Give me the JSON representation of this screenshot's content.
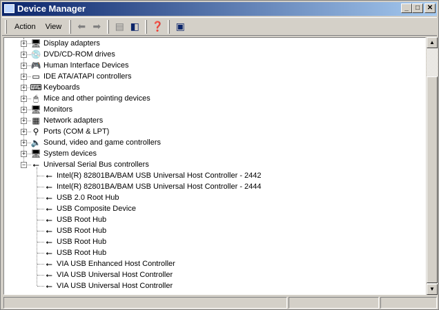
{
  "window": {
    "title": "Device Manager"
  },
  "menu": [
    {
      "label": "Action",
      "key": "A"
    },
    {
      "label": "View",
      "key": "V"
    }
  ],
  "toolbar": {
    "icons": [
      "back-icon",
      "forward-icon",
      "up-folder-icon",
      "show-hide-tree-icon",
      "help-icon",
      "properties-icon"
    ]
  },
  "tree": {
    "categories": [
      {
        "label": "Display adapters",
        "icon": "monitor-icon",
        "expanded": false
      },
      {
        "label": "DVD/CD-ROM drives",
        "icon": "cdrom-icon",
        "expanded": false
      },
      {
        "label": "Human Interface Devices",
        "icon": "hid-icon",
        "expanded": false
      },
      {
        "label": "IDE ATA/ATAPI controllers",
        "icon": "ide-icon",
        "expanded": false
      },
      {
        "label": "Keyboards",
        "icon": "keyboard-icon",
        "expanded": false
      },
      {
        "label": "Mice and other pointing devices",
        "icon": "mouse-icon",
        "expanded": false
      },
      {
        "label": "Monitors",
        "icon": "monitor-icon",
        "expanded": false
      },
      {
        "label": "Network adapters",
        "icon": "network-icon",
        "expanded": false
      },
      {
        "label": "Ports (COM & LPT)",
        "icon": "port-icon",
        "expanded": false
      },
      {
        "label": "Sound, video and game controllers",
        "icon": "sound-icon",
        "expanded": false
      },
      {
        "label": "System devices",
        "icon": "computer-icon",
        "expanded": false
      },
      {
        "label": "Universal Serial Bus controllers",
        "icon": "usb-icon",
        "expanded": true
      }
    ],
    "usb_children": [
      "Intel(R) 82801BA/BAM USB Universal Host Controller - 2442",
      "Intel(R) 82801BA/BAM USB Universal Host Controller - 2444",
      "USB 2.0 Root Hub",
      "USB Composite Device",
      "USB Root Hub",
      "USB Root Hub",
      "USB Root Hub",
      "USB Root Hub",
      "VIA USB Enhanced Host Controller",
      "VIA USB Universal Host Controller",
      "VIA USB Universal Host Controller"
    ]
  }
}
